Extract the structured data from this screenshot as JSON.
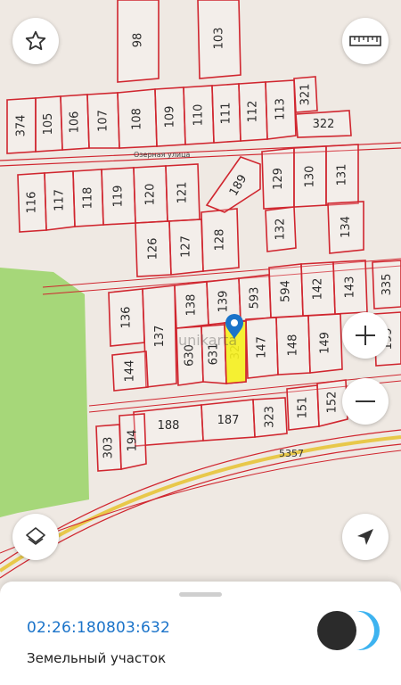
{
  "map": {
    "parcels": [
      "98",
      "103",
      "374",
      "105",
      "106",
      "107",
      "108",
      "109",
      "110",
      "111",
      "112",
      "113",
      "321",
      "322",
      "116",
      "117",
      "118",
      "119",
      "120",
      "121",
      "126",
      "127",
      "128",
      "189",
      "129",
      "130",
      "131",
      "132",
      "134",
      "136",
      "137",
      "138",
      "139",
      "593",
      "594",
      "142",
      "143",
      "335",
      "630",
      "631",
      "32",
      "147",
      "148",
      "149",
      "199",
      "144",
      "188",
      "187",
      "323",
      "151",
      "152",
      "303",
      "194"
    ],
    "street_name": "Озерная улица",
    "road_number": "5357",
    "watermark": "unikarta",
    "colors": {
      "parcel_border": "#d0262f",
      "selected_fill": "#f5f01e",
      "forest": "#a6d779",
      "pin": "#1a73c9"
    }
  },
  "controls": {
    "favorite": "star-icon",
    "ruler": "ruler-icon",
    "zoom_in": "+",
    "zoom_out": "−",
    "layers": "layers-icon",
    "locate": "navigation-arrow-icon"
  },
  "info": {
    "cadastral_number": "02:26:180803:632",
    "parcel_type": "Земельный участок"
  }
}
